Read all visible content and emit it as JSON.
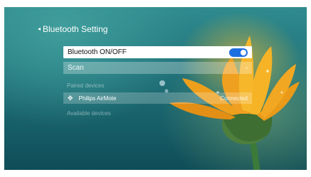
{
  "header": {
    "back_glyph": "◂",
    "title": "Bluetooth Setting"
  },
  "menu": {
    "bluetooth_toggle": {
      "label": "Bluetooth ON/OFF",
      "state": "on",
      "accent_color": "#1e6fe0"
    },
    "scan": {
      "label": "Scan",
      "arrow_glyph": "›"
    }
  },
  "paired": {
    "heading": "Paired devices",
    "devices": [
      {
        "icon": "bluetooth-device-icon",
        "name": "Philips AirMote",
        "status": "Connected"
      }
    ]
  },
  "available": {
    "heading": "Available devices"
  }
}
